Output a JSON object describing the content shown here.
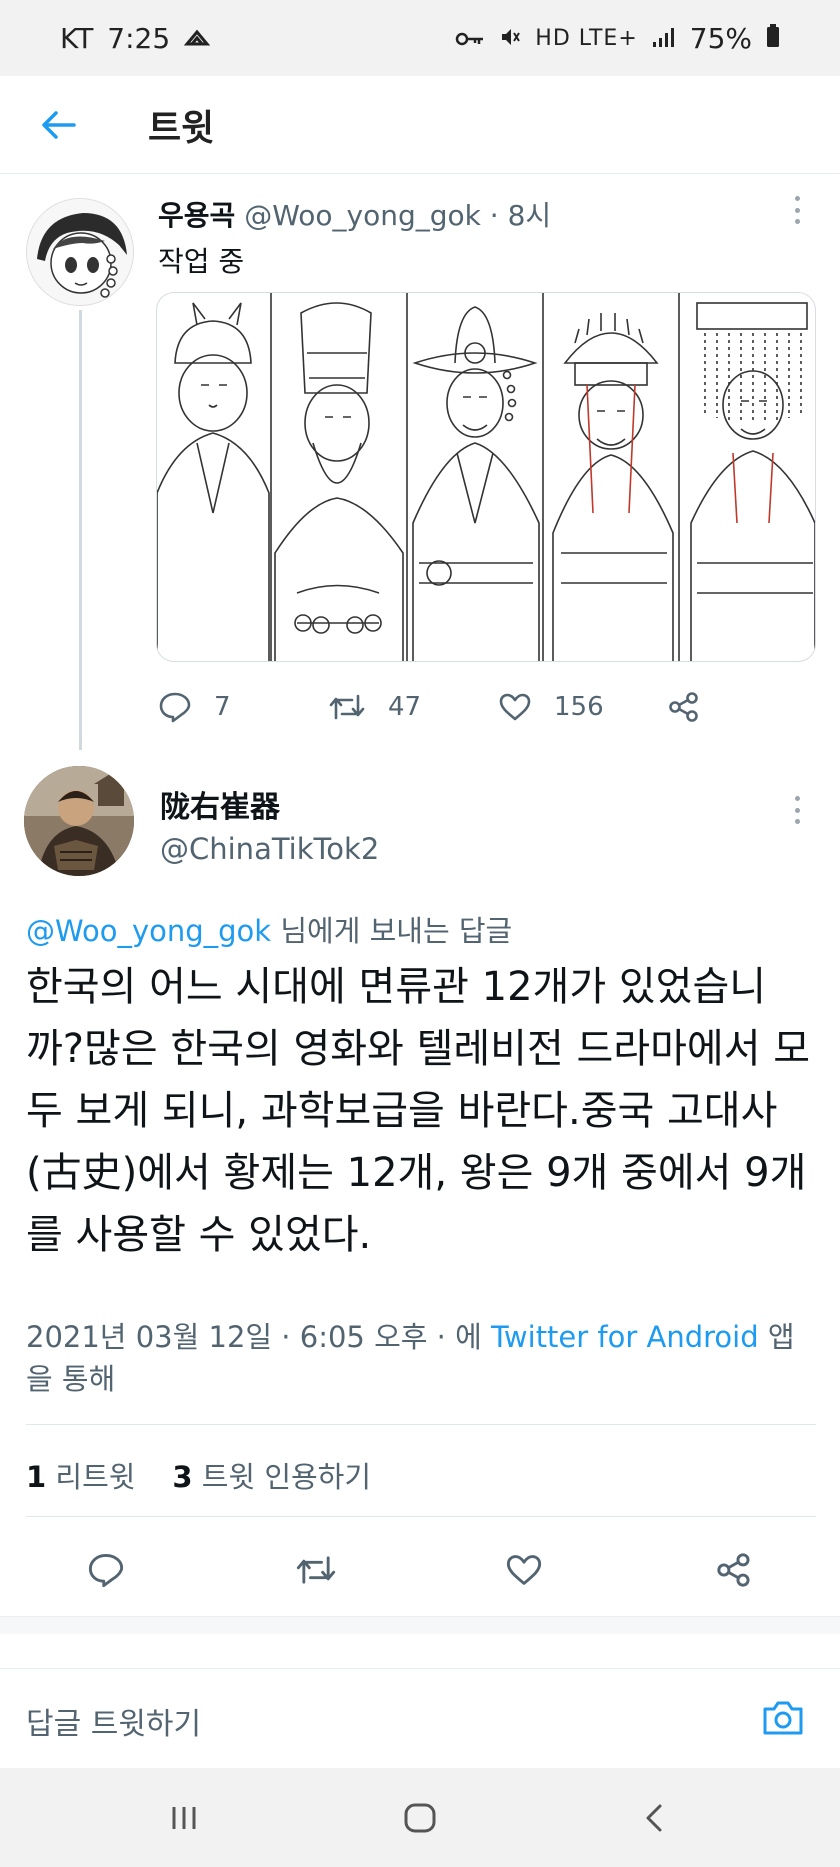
{
  "status_bar": {
    "carrier": "KT",
    "time": "7:25",
    "network": "HD LTE+",
    "battery": "75%"
  },
  "header": {
    "title": "트윗"
  },
  "tweet1": {
    "name": "우용곡",
    "handle": "@Woo_yong_gok",
    "time": "8시",
    "text": "작업 중",
    "replies": "7",
    "retweets": "47",
    "likes": "156"
  },
  "tweet2": {
    "name": "陇右崔器",
    "handle": "@ChinaTikTok2",
    "replying_handle": "@Woo_yong_gok",
    "replying_suffix": " 님에게 보내는 답글",
    "body": "한국의 어느 시대에 면류관 12개가 있었습니까?많은 한국의 영화와 텔레비전 드라마에서 모두 보게 되니, 과학보급을 바란다.중국 고대사 (古史)에서 황제는 12개, 왕은 9개 중에서 9개를 사용할 수 있었다.",
    "date": "2021년 03월 12일 · 6:05 오후 · 에 ",
    "source": "Twitter for Android",
    "source_suffix": " 앱을 통해",
    "retweet_count": "1",
    "retweet_label": "리트윗",
    "quote_count": "3",
    "quote_label": "트윗 인용하기"
  },
  "reply_bar": {
    "placeholder": "답글 트윗하기"
  },
  "colors": {
    "accent": "#1d9bf0",
    "secondary_text": "#536471",
    "primary_text": "#0f1419"
  }
}
